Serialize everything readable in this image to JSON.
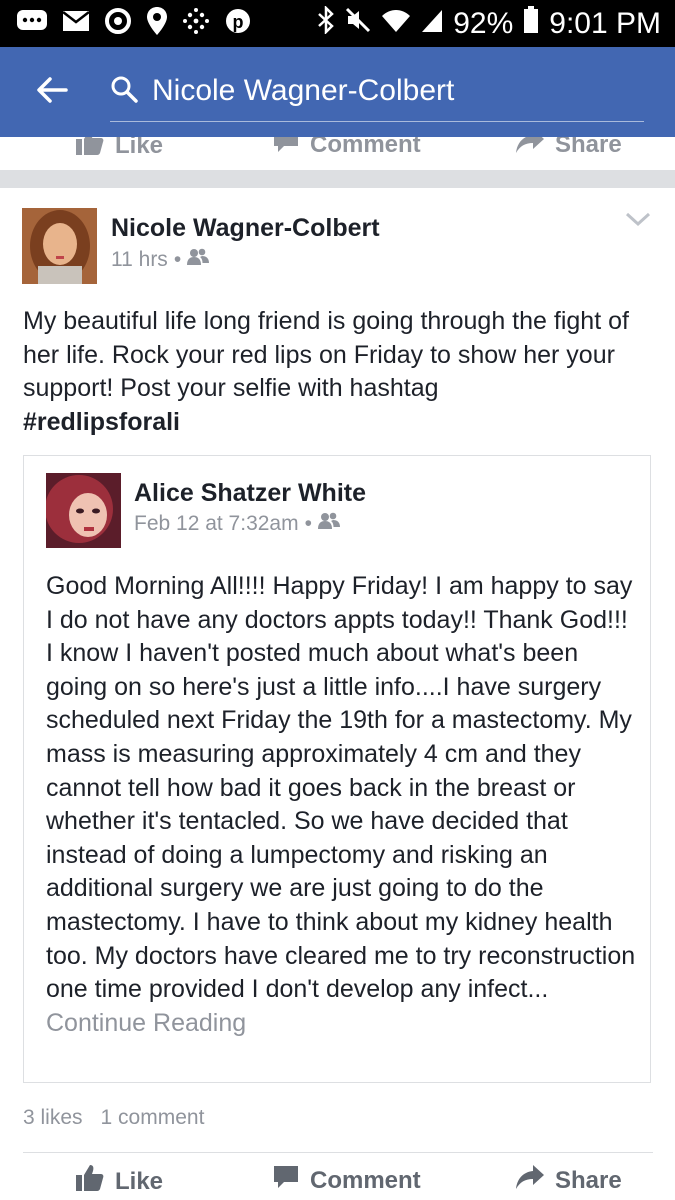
{
  "status_bar": {
    "battery": "92%",
    "time": "9:01 PM"
  },
  "app_bar": {
    "search_query": "Nicole Wagner-Colbert"
  },
  "previous_post_actions": {
    "like": "Like",
    "comment": "Comment",
    "share": "Share"
  },
  "post": {
    "author": "Nicole Wagner-Colbert",
    "time": "11 hrs",
    "text": "My beautiful life long friend is going through the fight of her life. Rock your red lips on Friday to show her your support! Post your selfie with hashtag",
    "hashtag": "#redlipsforali",
    "shared": {
      "author": "Alice Shatzer White",
      "time": "Feb 12 at 7:32am",
      "text": "Good Morning All!!!!  Happy Friday!  I am happy to say I do not have any doctors appts today!!  Thank God!!!  I know I haven't posted much about what's been going on so here's just a little info....I have surgery scheduled next Friday the 19th for a mastectomy. My mass is measuring approximately 4 cm and they cannot tell how bad it goes back in the breast or whether it's tentacled. So we have decided that instead of doing a lumpectomy and risking an additional surgery we are just going to do the mastectomy. I have to think about my kidney health too. My doctors have cleared me to try reconstruction one time provided I don't develop any infect...",
      "continue_label": "Continue Reading"
    },
    "likes": "3 likes",
    "comments": "1 comment",
    "actions": {
      "like": "Like",
      "comment": "Comment",
      "share": "Share"
    }
  },
  "colors": {
    "brand_blue": "#4267b2",
    "text": "#1d2129",
    "muted": "#90949c",
    "divider": "#dddfe2"
  }
}
